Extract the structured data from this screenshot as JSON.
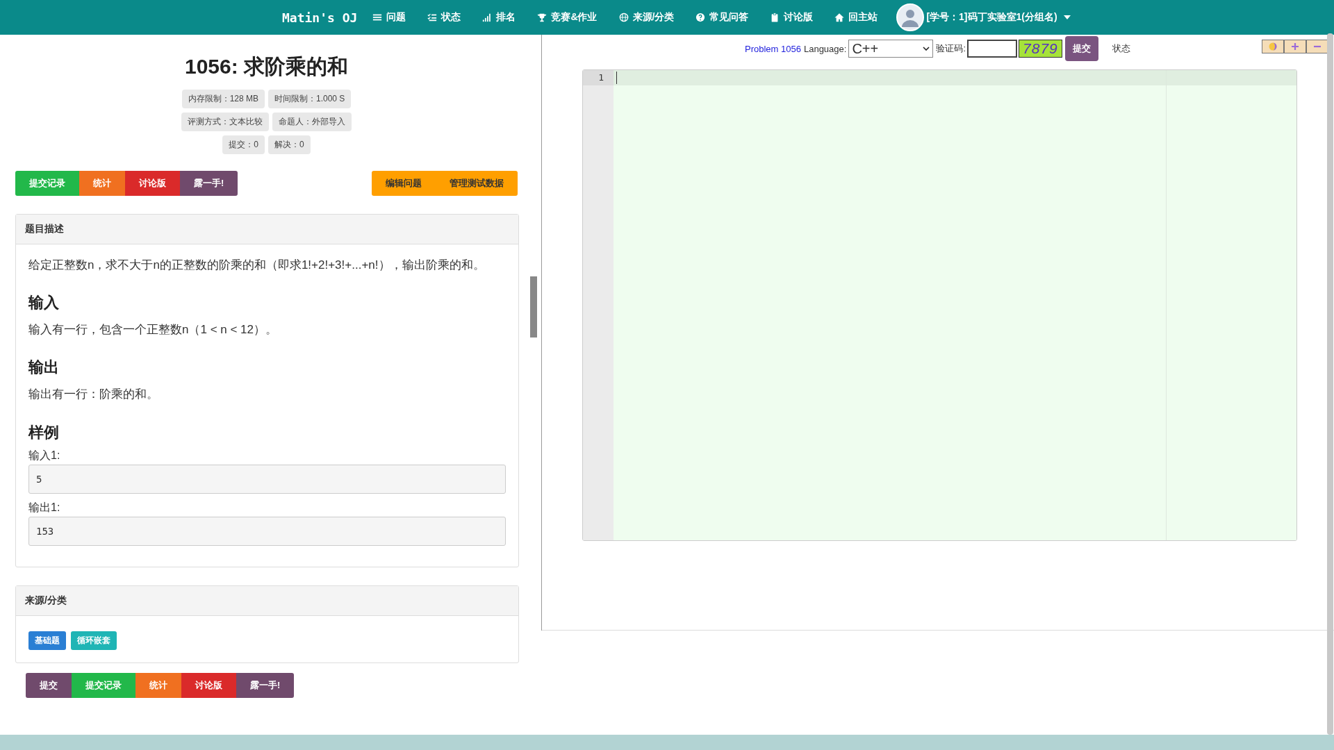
{
  "navbar": {
    "brand": "Matin's OJ",
    "items": [
      {
        "label": "问题"
      },
      {
        "label": "状态"
      },
      {
        "label": "排名"
      },
      {
        "label": "竞赛&作业"
      },
      {
        "label": "来源/分类"
      },
      {
        "label": "常见问答"
      },
      {
        "label": "讨论版"
      },
      {
        "label": "回主站"
      }
    ],
    "user": {
      "label": "[学号：1]码丁实验室1(分组名)"
    }
  },
  "problem": {
    "title": "1056: 求阶乘的和",
    "badge_rows": [
      [
        "内存限制：128 MB",
        "时间限制：1.000 S"
      ],
      [
        "评测方式：文本比较",
        "命题人：外部导入"
      ],
      [
        "提交：0",
        "解决：0"
      ]
    ],
    "actions": [
      {
        "label": "提交记录",
        "color": "#22b84a"
      },
      {
        "label": "统计",
        "color": "#f07020"
      },
      {
        "label": "讨论版",
        "color": "#da2a2a"
      },
      {
        "label": "露一手!",
        "color": "#704a6c"
      }
    ],
    "admin_actions": [
      {
        "label": "编辑问题"
      },
      {
        "label": "管理测试数据"
      }
    ],
    "description": {
      "heading": "题目描述",
      "blocks": [
        {
          "kind": "text",
          "text": "给定正整数n，求不大于n的正整数的阶乘的和（即求1!+2!+3!+...+n!），输出阶乘的和。"
        },
        {
          "kind": "heading",
          "text": "输入"
        },
        {
          "kind": "text",
          "text": "输入有一行，包含一个正整数n（1 < n < 12）。"
        },
        {
          "kind": "heading",
          "text": "输出"
        },
        {
          "kind": "text",
          "text": "输出有一行：阶乘的和。"
        },
        {
          "kind": "heading",
          "text": "样例"
        },
        {
          "kind": "label",
          "text": "输入1:"
        },
        {
          "kind": "sample",
          "text": "5"
        },
        {
          "kind": "label",
          "text": "输出1:"
        },
        {
          "kind": "sample",
          "text": "153"
        }
      ]
    },
    "source": {
      "heading": "来源/分类",
      "tags": [
        {
          "label": "基础题",
          "color": "#2a7fd4"
        },
        {
          "label": "循环嵌套",
          "color": "#1fb5b5"
        }
      ]
    },
    "bottom_actions": [
      {
        "label": "提交",
        "color": "#704a6c"
      },
      {
        "label": "提交记录",
        "color": "#22b84a"
      },
      {
        "label": "统计",
        "color": "#f07020"
      },
      {
        "label": "讨论版",
        "color": "#da2a2a"
      },
      {
        "label": "露一手!",
        "color": "#704a6c"
      }
    ]
  },
  "submit_bar": {
    "problem_link": "Problem 1056",
    "language_label": "Language:",
    "language": "C++",
    "captcha_label": "验证码:",
    "captcha_code": "7879",
    "submit": "提交",
    "status": "状态"
  },
  "editor": {
    "line_numbers": [
      "1"
    ]
  }
}
